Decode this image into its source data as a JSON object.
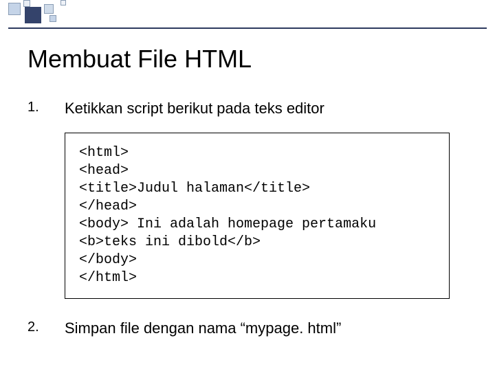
{
  "title": "Membuat File HTML",
  "items": [
    {
      "num": "1.",
      "text": "Ketikkan script berikut pada teks editor"
    },
    {
      "num": "2.",
      "text": "Simpan file dengan nama “mypage. html”"
    }
  ],
  "code": {
    "l1": "<html>",
    "l2": "<head>",
    "l3": "<title>Judul halaman</title>",
    "l4": "</head>",
    "l5": "<body> Ini adalah homepage pertamaku",
    "l6": "<b>teks ini dibold</b>",
    "l7": "</body>",
    "l8": "</html>"
  }
}
